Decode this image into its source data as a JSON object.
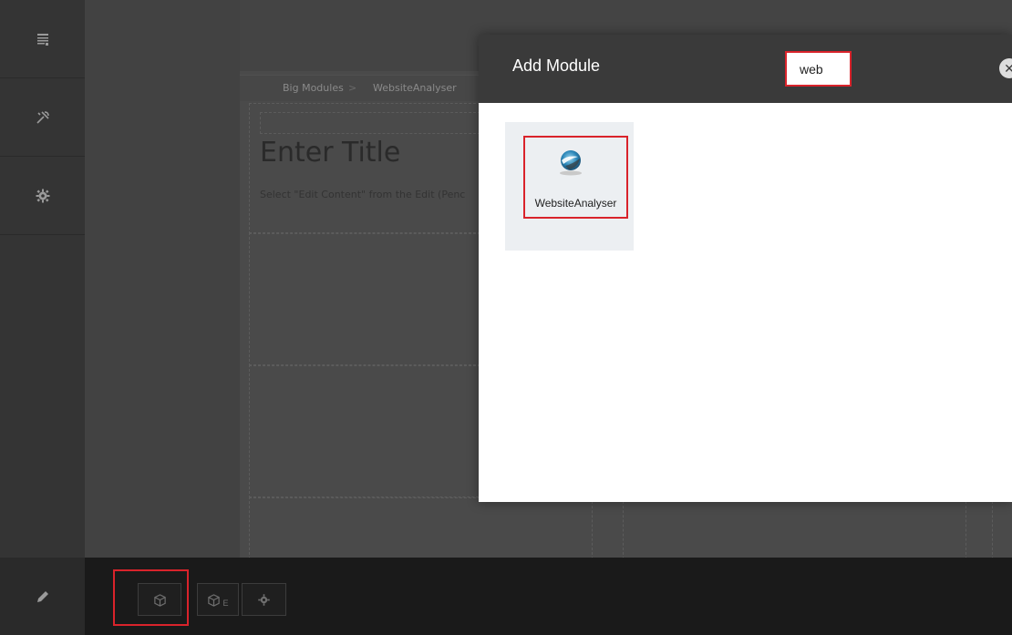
{
  "breadcrumb": {
    "items": [
      "Big Modules",
      "WebsiteAnalyser"
    ],
    "separator": ">"
  },
  "page": {
    "title": "Enter Title",
    "description": "Select \"Edit Content\" from the Edit (Penc"
  },
  "modal": {
    "title": "Add Module",
    "search_value": "web",
    "close_icon": "close-icon",
    "modules": [
      {
        "label": "WebsiteAnalyser",
        "icon": "website-analyser-logo"
      }
    ]
  },
  "sidebar": {
    "items": [
      {
        "icon": "pages-icon"
      },
      {
        "icon": "tools-icon"
      },
      {
        "icon": "settings-icon"
      }
    ],
    "edit_icon": "pencil-icon"
  },
  "bottom_toolbar": {
    "buttons": [
      {
        "icon": "add-module-icon"
      },
      {
        "icon": "add-existing-module-icon",
        "suffix": "E"
      },
      {
        "icon": "settings-icon"
      }
    ]
  },
  "colors": {
    "highlight": "#d9232b",
    "modal_header": "#3a3a3a",
    "rail": "#343434"
  }
}
